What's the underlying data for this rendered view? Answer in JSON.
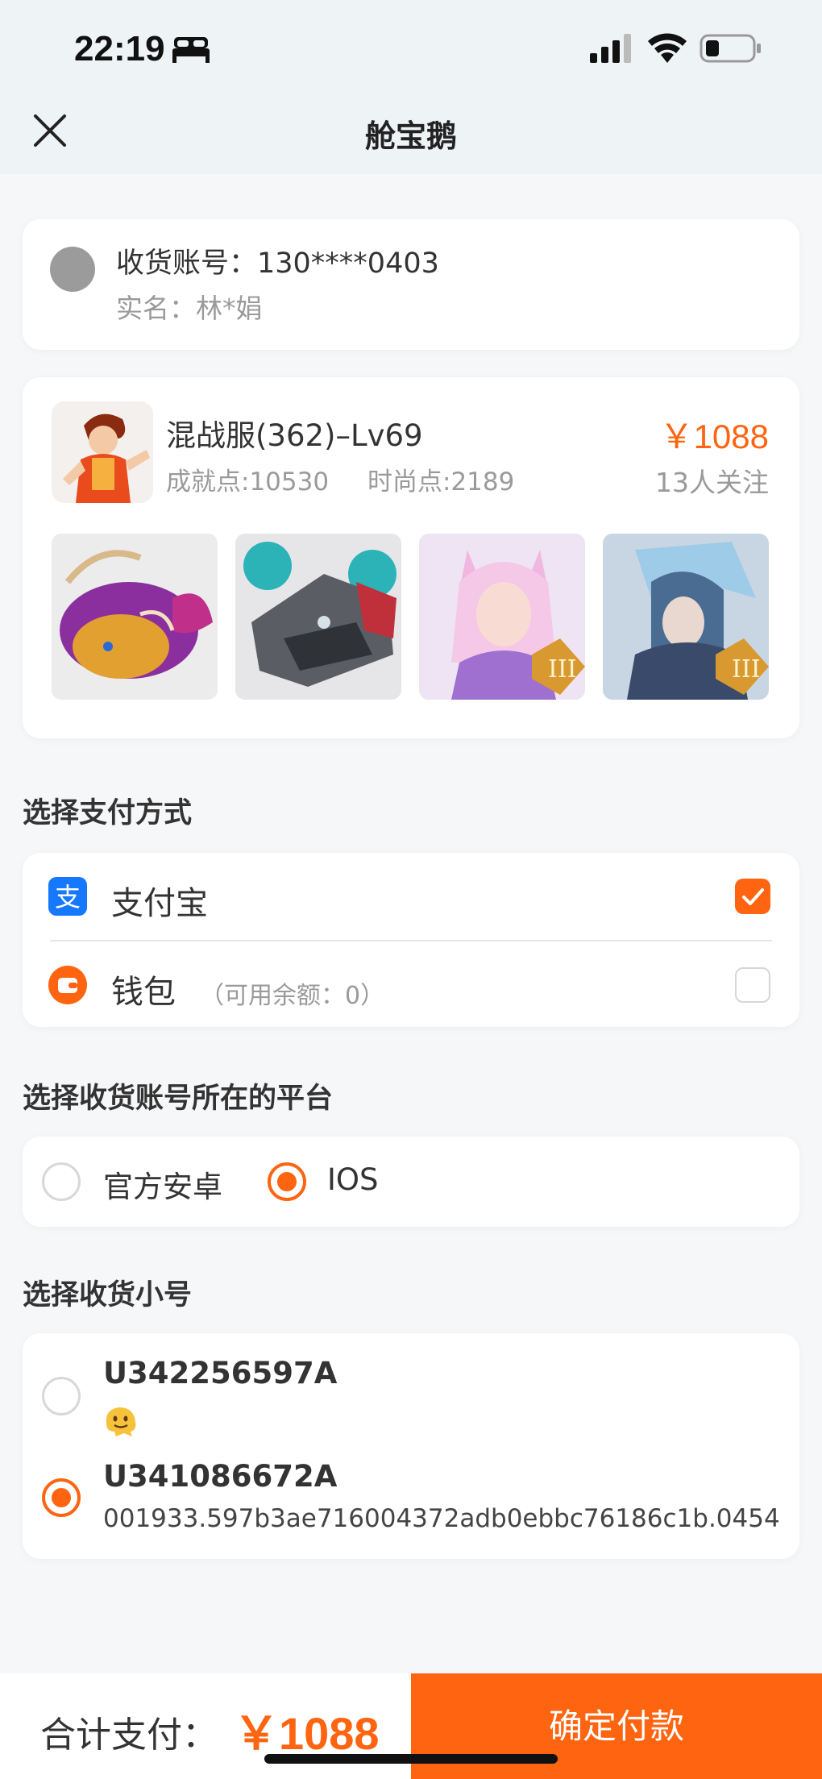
{
  "status_bar": {
    "time": "22:19",
    "icons": [
      "bed-icon",
      "signal-icon",
      "wifi-icon",
      "battery-icon"
    ]
  },
  "nav": {
    "title": "舱宝鹅",
    "close_icon": "close-icon"
  },
  "receiver": {
    "account": "收货账号：130****0403",
    "real_name": "实名：林*娟"
  },
  "product": {
    "title": "混战服(362)–Lv69",
    "achievement": "成就点:10530",
    "fashion": "时尚点:2189",
    "price": "￥1088",
    "followers": "13人关注",
    "thumbnails": [
      "fish-mount-image",
      "mech-wolf-image",
      "fox-girl-skin-image",
      "ice-warrior-skin-image"
    ]
  },
  "payment": {
    "section_title": "选择支付方式",
    "options": [
      {
        "label": "支付宝",
        "note": "",
        "checked": true,
        "icon": "alipay-icon"
      },
      {
        "label": "钱包",
        "note": "（可用余额：0）",
        "checked": false,
        "icon": "wallet-icon"
      }
    ]
  },
  "platform": {
    "section_title": "选择收货账号所在的平台",
    "options": [
      {
        "label": "官方安卓",
        "selected": false
      },
      {
        "label": "IOS",
        "selected": true
      }
    ]
  },
  "alt_accounts": {
    "section_title": "选择收货小号",
    "items": [
      {
        "id": "U342256597A",
        "sub": "",
        "selected": false,
        "icon": "melting-face-emoji-icon"
      },
      {
        "id": "U341086672A",
        "sub": "001933.597b3ae716004372adb0ebbc76186c1b.0454",
        "selected": true
      }
    ]
  },
  "footer": {
    "total_label": "合计支付：",
    "total_value": "￥1088",
    "confirm_label": "确定付款"
  },
  "colors": {
    "accent": "#ff6410",
    "header_bg": "#eef3f6",
    "page_bg": "#f6f7f9",
    "alipay_blue": "#1677ff"
  }
}
